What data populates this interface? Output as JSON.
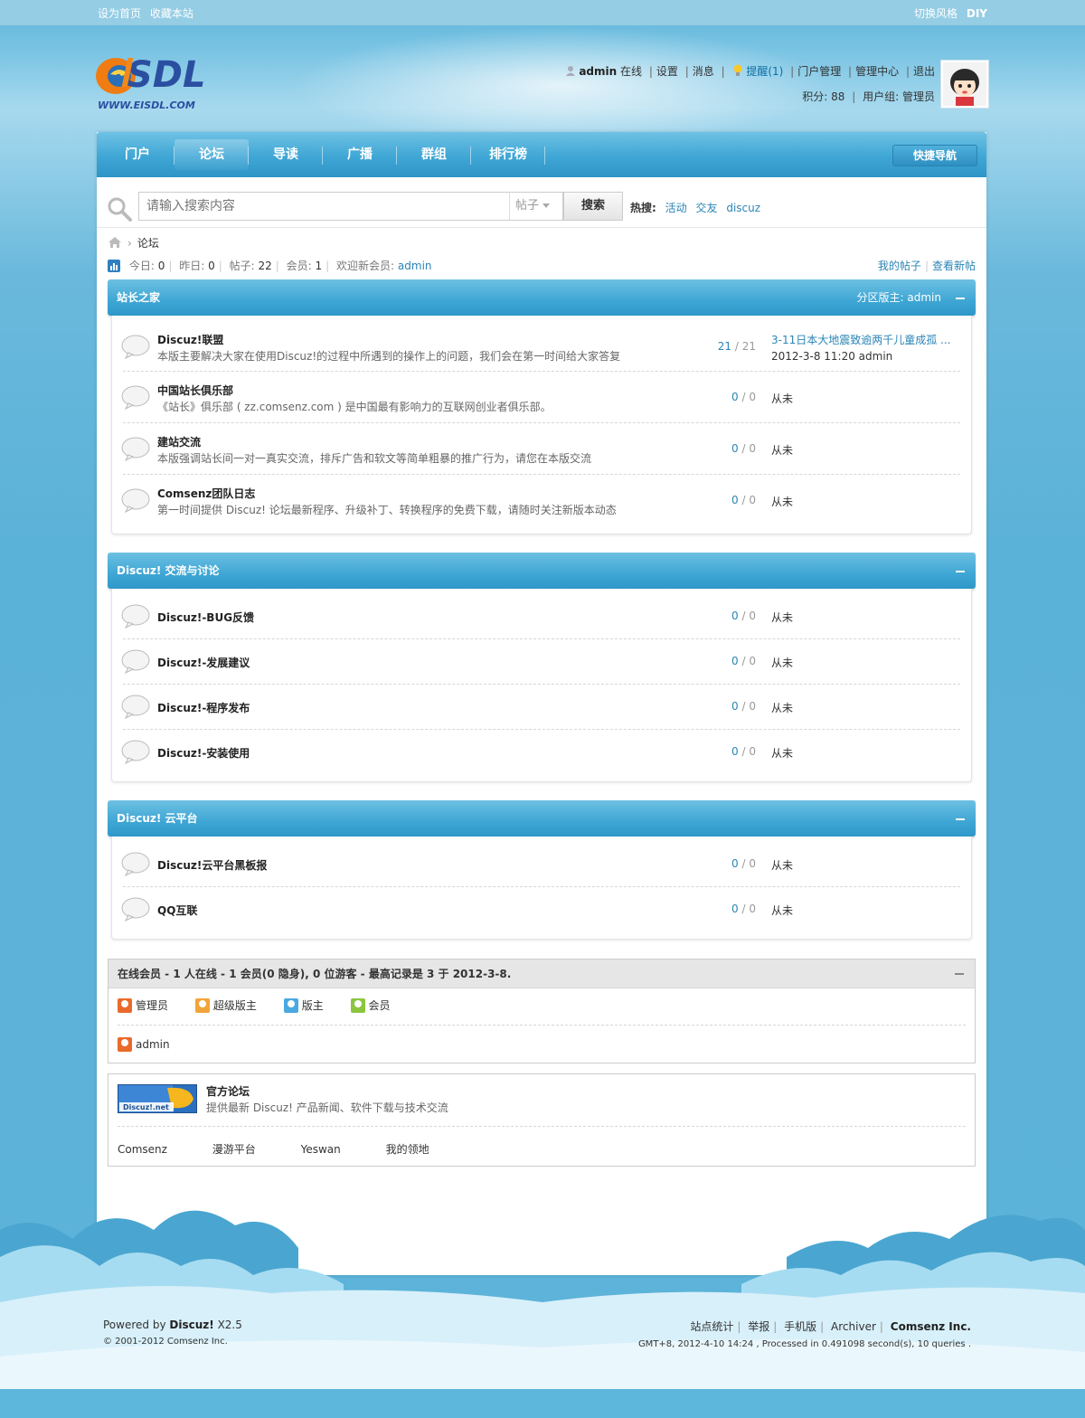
{
  "topbar": {
    "set_home": "设为首页",
    "bookmark": "收藏本站",
    "switch_style": "切换风格",
    "diy": "DIY"
  },
  "logo": {
    "url_text": "WWW.EISDL.COM"
  },
  "user": {
    "name": "admin",
    "online": "在线",
    "links": [
      "设置",
      "消息"
    ],
    "remind": "提醒(1)",
    "links2": [
      "门户管理",
      "管理中心",
      "退出"
    ],
    "points_label": "积分: 88",
    "group_label": "用户组: 管理员"
  },
  "nav": {
    "items": [
      "门户",
      "论坛",
      "导读",
      "广播",
      "群组",
      "排行榜"
    ],
    "active": "论坛",
    "quick": "快捷导航"
  },
  "search": {
    "placeholder": "请输入搜索内容",
    "type": "帖子",
    "button": "搜索",
    "hot_label": "热搜:",
    "hot": [
      "活动",
      "交友",
      "discuz"
    ]
  },
  "breadcrumb": {
    "current": "论坛"
  },
  "stats": {
    "today_label": "今日:",
    "today": "0",
    "yesterday_label": "昨日:",
    "yesterday": "0",
    "posts_label": "帖子:",
    "posts": "22",
    "members_label": "会员:",
    "members": "1",
    "welcome": "欢迎新会员:",
    "newest": "admin",
    "my_posts": "我的帖子",
    "new_posts": "查看新帖"
  },
  "categories": [
    {
      "title": "站长之家",
      "moderator": "分区版主: admin",
      "forums": [
        {
          "name": "Discuz!联盟",
          "desc": "本版主要解决大家在使用Discuz!的过程中所遇到的操作上的问题，我们会在第一时间给大家答复",
          "threads": "21",
          "posts": "21",
          "last_title": "3-11日本大地震致逾两千儿童成孤 ...",
          "last_date": "2012-3-8 11:20 admin"
        },
        {
          "name": "中国站长俱乐部",
          "desc": "《站长》俱乐部 ( zz.comsenz.com ) 是中国最有影响力的互联网创业者俱乐部。",
          "threads": "0",
          "posts": "0",
          "last": "从未"
        },
        {
          "name": "建站交流",
          "desc": "本版强调站长间一对一真实交流，排斥广告和软文等简单粗暴的推广行为，请您在本版交流",
          "threads": "0",
          "posts": "0",
          "last": "从未"
        },
        {
          "name": "Comsenz团队日志",
          "desc": "第一时间提供 Discuz! 论坛最新程序、升级补丁、转换程序的免费下载，请随时关注新版本动态",
          "threads": "0",
          "posts": "0",
          "last": "从未"
        }
      ]
    },
    {
      "title": "Discuz! 交流与讨论",
      "forums": [
        {
          "name": "Discuz!-BUG反馈",
          "threads": "0",
          "posts": "0",
          "last": "从未"
        },
        {
          "name": "Discuz!-发展建议",
          "threads": "0",
          "posts": "0",
          "last": "从未"
        },
        {
          "name": "Discuz!-程序发布",
          "threads": "0",
          "posts": "0",
          "last": "从未"
        },
        {
          "name": "Discuz!-安装使用",
          "threads": "0",
          "posts": "0",
          "last": "从未"
        }
      ]
    },
    {
      "title": "Discuz! 云平台",
      "forums": [
        {
          "name": "Discuz!云平台黑板报",
          "threads": "0",
          "posts": "0",
          "last": "从未"
        },
        {
          "name": "QQ互联",
          "threads": "0",
          "posts": "0",
          "last": "从未"
        }
      ]
    }
  ],
  "online": {
    "title": "在线会员 - 1 人在线 - 1 会员(0 隐身), 0 位游客 - 最高记录是 3 于 2012-3-8.",
    "legend": [
      "管理员",
      "超级版主",
      "版主",
      "会员"
    ],
    "users": [
      "admin"
    ]
  },
  "friend_links": {
    "logo_text": "Discuz!.net",
    "title": "官方论坛",
    "desc": "提供最新 Discuz! 产品新闻、软件下载与技术交流",
    "text_links": [
      "Comsenz",
      "漫游平台",
      "Yeswan",
      "我的领地"
    ]
  },
  "footer": {
    "powered_prefix": "Powered by",
    "powered_name": "Discuz!",
    "version": "X2.5",
    "copyright": "© 2001-2012 Comsenz Inc.",
    "links": [
      "站点统计",
      "举报",
      "手机版",
      "Archiver"
    ],
    "company": "Comsenz Inc.",
    "processed": "GMT+8, 2012-4-10 14:24 , Processed in 0.491098 second(s), 10 queries ."
  }
}
